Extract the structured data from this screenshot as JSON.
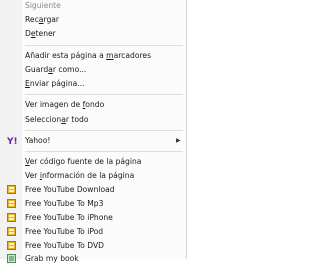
{
  "menu": {
    "siguiente": "Siguiente",
    "recargar": {
      "pre": "Rec",
      "key": "a",
      "post": "rgar"
    },
    "detener": {
      "pre": "D",
      "key": "e",
      "post": "tener"
    },
    "anadir_marcadores": {
      "pre": "Añadir esta página a ",
      "key": "m",
      "post": "arcadores"
    },
    "guardar_como": {
      "pre": "Guard",
      "key": "a",
      "post": "r como..."
    },
    "enviar_pagina": {
      "pre": "",
      "key": "E",
      "post": "nviar página..."
    },
    "ver_imagen_fondo": {
      "pre": "Ver imagen de ",
      "key": "f",
      "post": "ondo"
    },
    "seleccionar_todo": {
      "pre": "Seleccion",
      "key": "a",
      "post": "r todo"
    },
    "yahoo": "Yahoo!",
    "ver_codigo": {
      "pre": "",
      "key": "V",
      "post": "er código fuente de la página"
    },
    "ver_informacion": {
      "pre": "Ver ",
      "key": "i",
      "post": "nformación de la página"
    },
    "free_yt_download": "Free YouTube Download",
    "free_yt_mp3": "Free YouTube To Mp3",
    "free_yt_iphone": "Free YouTube To iPhone",
    "free_yt_ipod": "Free YouTube To iPod",
    "free_yt_dvd": "Free YouTube To DVD",
    "grab_my_book": "Grab my book"
  },
  "icons": {
    "yahoo": "yahoo-icon",
    "dvdvideosoft": "dvdvideosoft-icon",
    "book": "book-icon"
  },
  "colors": {
    "menu_bg": "#fbfbfb",
    "disabled_text": "#8a8a8a",
    "yahoo_purple": "#6b1fb1",
    "dvdvideosoft_yellow": "#e9b221"
  }
}
